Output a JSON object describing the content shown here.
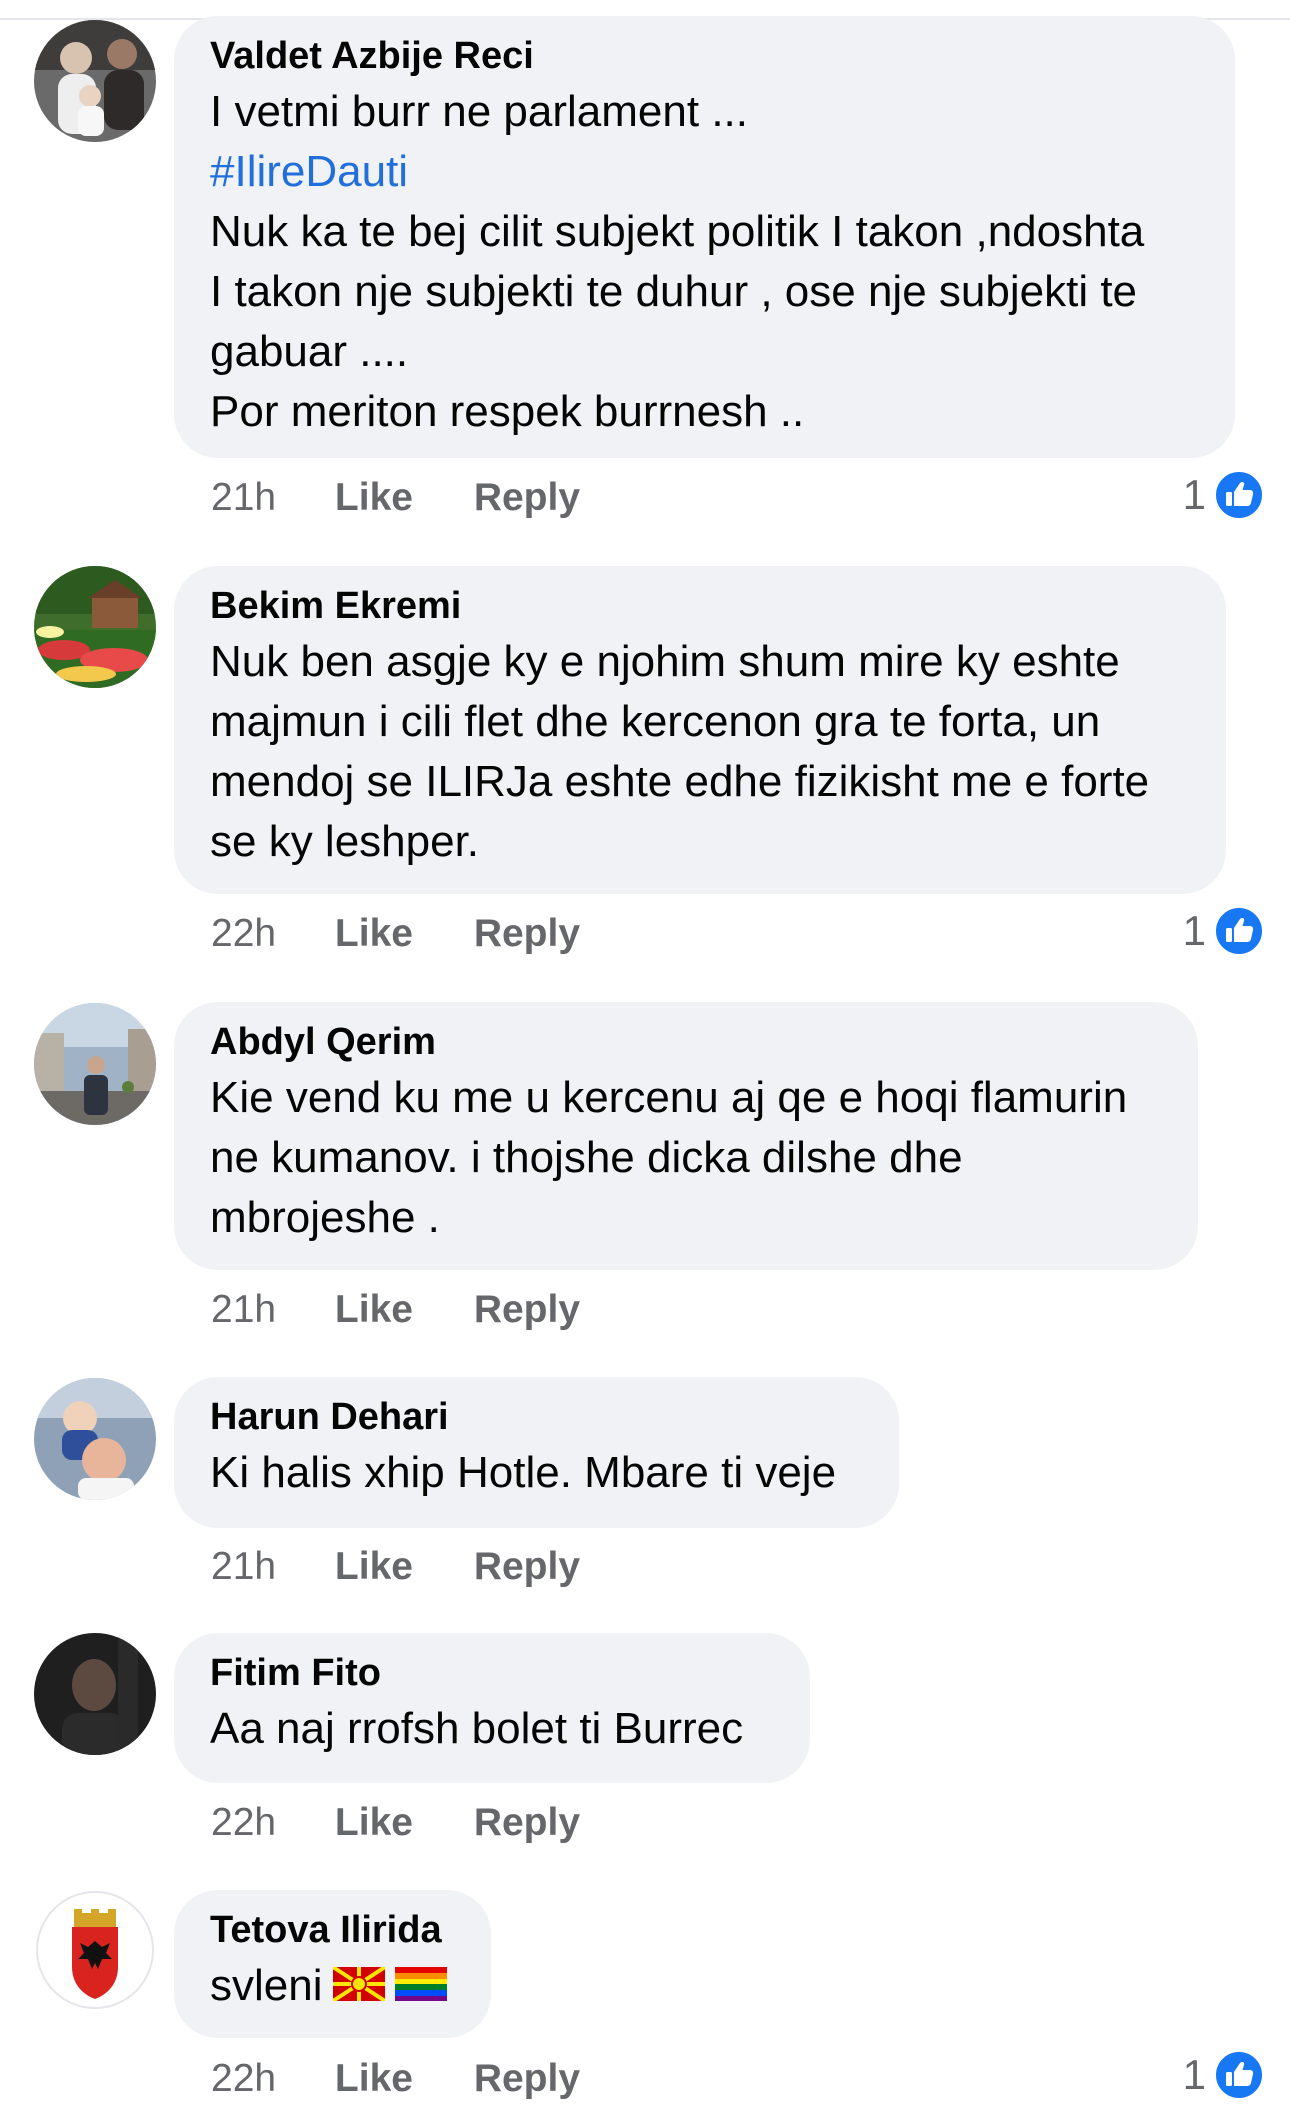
{
  "colors": {
    "bubble": "#f0f2f5",
    "meta_text": "#65676b",
    "hashtag": "#216fdb",
    "like_blue": "#1877f2"
  },
  "actions": {
    "like": "Like",
    "reply": "Reply"
  },
  "comments": [
    {
      "author": "Valdet Azbije Reci",
      "lines": [
        "I vetmi  burr ne parlament ...",
        "#IlireDauti",
        "Nuk ka te bej cilit subjekt politik I takon ,ndoshta",
        "I takon nje subjekti te duhur , ose nje subjekti te",
        "gabuar ....",
        "Por meriton respek  burrnesh .."
      ],
      "time": "21h",
      "reactions": "1",
      "reaction_icon": "thumbs-up-icon"
    },
    {
      "author": "Bekim Ekremi",
      "lines": [
        "Nuk ben asgje ky e njohim shum mire ky eshte",
        "majmun i cili flet dhe kercenon gra te forta, un",
        "mendoj se ILIRJa eshte edhe fizikisht me e forte",
        "se ky leshper."
      ],
      "time": "22h",
      "reactions": "1",
      "reaction_icon": "thumbs-up-icon"
    },
    {
      "author": "Abdyl Qerim",
      "lines": [
        "Kie vend ku me u kercenu aj qe e hoqi flamurin",
        "ne kumanov. i thojshe dicka dilshe dhe",
        "mbrojeshe ."
      ],
      "time": "21h"
    },
    {
      "author": "Harun Dehari",
      "lines": [
        "Ki halis xhip Hotle. Mbare ti veje"
      ],
      "time": "21h"
    },
    {
      "author": "Fitim Fito",
      "lines": [
        "Aa naj rrofsh bolet ti Burrec"
      ],
      "time": "22h"
    },
    {
      "author": "Tetova Ilirida",
      "lines": [
        "svleni"
      ],
      "emojis": [
        "north-macedonia-flag-icon",
        "rainbow-flag-icon"
      ],
      "time": "22h",
      "reactions": "1",
      "reaction_icon": "thumbs-up-icon"
    }
  ]
}
